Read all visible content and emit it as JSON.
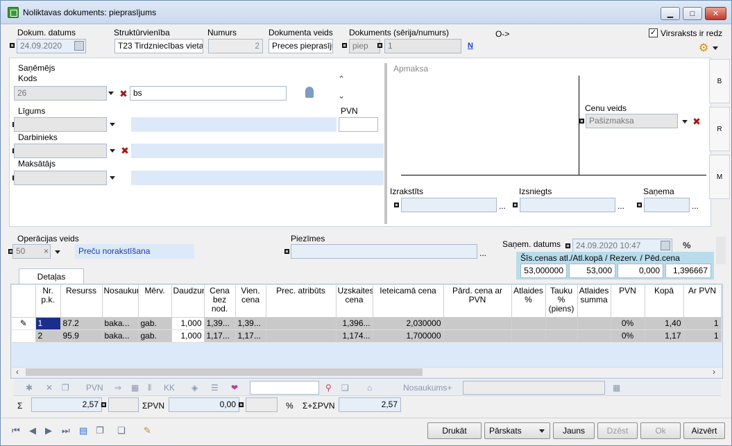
{
  "window": {
    "title": "Noliktavas dokuments: pieprasījums",
    "minimize": "▁",
    "maximize": "□",
    "close": "✕"
  },
  "header": {
    "dokum_datums_label": "Dokum. datums",
    "dokum_datums": "24.09.2020",
    "struktur_label": "Struktūrvienība",
    "struktur_value": "T23 Tirdzniecības vieta",
    "numurs_label": "Numurs",
    "numurs_value": "2",
    "dok_veids_label": "Dokumenta veids",
    "dok_veids_value": "Preces pieprasījums",
    "dokuments_label": "Dokuments (sērija/numurs)",
    "serija_value": "piep",
    "numurs2_value": "1",
    "arrow_text": "O->",
    "n_link": "N",
    "virsraksts_label": "Virsraksts ir redz",
    "virsraksts_checked": true
  },
  "sanemejs": {
    "group_label": "Saņēmējs",
    "kods_label": "Kods",
    "kods_value": "26",
    "kods_name": "bs",
    "ligums_label": "Līgums",
    "ligums_value": "",
    "pvn_label": "PVN",
    "pvn_value": "",
    "darbinieks_label": "Darbinieks",
    "darbinieks_value": "",
    "maksatajs_label": "Maksātājs",
    "maksatajs_value": ""
  },
  "apmaksa": {
    "group_label": "Apmaksa",
    "cenu_veids_label": "Cenu veids",
    "cenu_veids_value": "Pašizmaksa",
    "izrakstits_label": "Izrakstīts",
    "izsniegts_label": "Izsniegts",
    "sanema_label": "Saņema",
    "ellipsis": "..."
  },
  "side_tabs": [
    "B",
    "R",
    "M"
  ],
  "operacijas": {
    "label": "Operācijas veids",
    "code": "50",
    "clear": "×",
    "name": "Preču norakstīšana",
    "piezimes_label": "Piezīmes",
    "piezimes_value": "",
    "sanem_datums_label": "Saņem. datums",
    "sanem_datums_value": "24.09.2020 10:47",
    "percent_icon": "%"
  },
  "sis_cenas": {
    "label": "Šīs.cenas atl./Atl.kopā / Rezerv. / Pēd.cena",
    "values": [
      "53,000000",
      "53,000",
      "0,000",
      "1,396667"
    ]
  },
  "tabs": {
    "detalas": "Detaļas"
  },
  "table": {
    "headers": [
      "Nr. p.k.",
      "Resurss",
      "Nosaukums",
      "Mērv.",
      "Daudzums",
      "Cena bez nod.",
      "Vien. cena",
      "Prec. atribūts",
      "Uzskaites cena",
      "Ieteicamā cena",
      "Pārd. cena ar PVN",
      "Atlaides %",
      "Tauku % (piens)",
      "Atlaides summa",
      "PVN",
      "Kopā",
      "Ar PVN"
    ],
    "rows": [
      [
        "1",
        "87.2",
        "baka...",
        "gab.",
        "1,000",
        "1,39...",
        "1,39...",
        "",
        "1,396...",
        "2,030000",
        "",
        "",
        "",
        "",
        "0%",
        "1,40",
        "1"
      ],
      [
        "2",
        "95.9",
        "baka...",
        "gab.",
        "1,000",
        "1,17...",
        "1,17...",
        "",
        "1,174...",
        "1,700000",
        "",
        "",
        "",
        "",
        "0%",
        "1,17",
        "1"
      ]
    ]
  },
  "toolbar": {
    "pvn": "PVN",
    "kk": "KK",
    "search_value": "",
    "nosaukums_plus": "Nosaukums+",
    "nosaukums_value": ""
  },
  "totals": {
    "sigma": "Σ",
    "sum": "2,57",
    "sum_pvn_label": "ΣPVN",
    "sum_pvn": "0,00",
    "percent": "%",
    "sum_total_label": "Σ+ΣPVN",
    "sum_total": "2,57"
  },
  "buttons": {
    "drukat": "Drukāt",
    "parskats": "Pārskats",
    "jauns": "Jauns",
    "dzest": "Dzēst",
    "ok": "Ok",
    "aizvert": "Aizvērt"
  },
  "colors": {
    "accent": "#1a2f8a",
    "link": "#1a3fd4",
    "field_blue": "#dce9f8"
  }
}
